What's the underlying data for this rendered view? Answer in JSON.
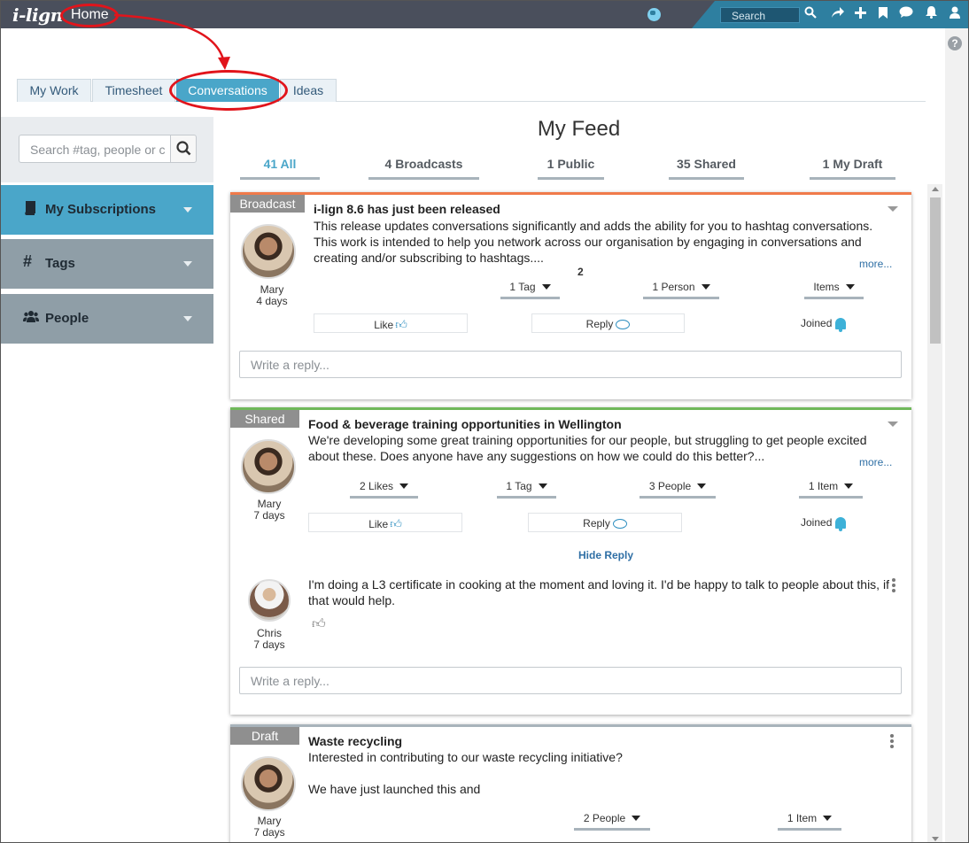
{
  "header": {
    "logo": "i-lign",
    "home": "Home",
    "search_placeholder": "Search",
    "icons": [
      "globe-icon",
      "search-icon",
      "share-icon",
      "plus-icon",
      "bookmark-icon",
      "chat-icon",
      "bell-icon",
      "user-icon"
    ]
  },
  "tabs": [
    "My Work",
    "Timesheet",
    "Conversations",
    "Ideas"
  ],
  "active_tab": "Conversations",
  "sidebar": {
    "search_placeholder": "Search #tag, people or c",
    "items": [
      {
        "label": "My Subscriptions",
        "icon": "book-icon",
        "color": "#4aa6c9"
      },
      {
        "label": "Tags",
        "icon": "hash-icon",
        "color": "#8f9ea7"
      },
      {
        "label": "People",
        "icon": "people-icon",
        "color": "#8f9ea7"
      }
    ]
  },
  "feed": {
    "title": "My Feed",
    "filters": [
      "41 All",
      "4 Broadcasts",
      "1 Public",
      "35 Shared",
      "1 My Draft"
    ]
  },
  "cards": [
    {
      "type": "Broadcast",
      "accent": "#f07a4a",
      "title": "i-lign 8.6 has just been released",
      "body": "This release updates conversations significantly and adds the ability for you to hashtag conversations.  This work is intended to help you network across our organisation by engaging in conversations and creating and/or subscribing to hashtags....",
      "more": "more...",
      "author": "Mary",
      "age": "4 days",
      "floating_count": "2",
      "meta": [
        "1 Tag",
        "1 Person",
        "Items"
      ],
      "like": "Like",
      "reply": "Reply",
      "joined": "Joined",
      "reply_placeholder": "Write a reply..."
    },
    {
      "type": "Shared",
      "accent": "#6fb85a",
      "title": "Food & beverage training opportunities in Wellington",
      "body": "We're developing some great training opportunities for our people, but struggling to get people excited about these. Does anyone have any suggestions on how we could do this better?...",
      "more": "more...",
      "author": "Mary",
      "age": "7 days",
      "meta": [
        "2 Likes",
        "1 Tag",
        "3 People",
        "1 Item"
      ],
      "like": "Like",
      "reply": "Reply",
      "joined": "Joined",
      "hide_reply": "Hide Reply",
      "comment": {
        "author": "Chris",
        "age": "7 days",
        "text": "I'm doing a L3 certificate in cooking at the moment and loving it. I'd be happy to talk to people about this, if that would help."
      },
      "reply_placeholder": "Write a reply..."
    },
    {
      "type": "Draft",
      "accent": "#a8b3bb",
      "title": "Waste recycling",
      "body_lines": [
        "Interested in contributing to our waste recycling initiative?",
        "We have just launched this and"
      ],
      "author": "Mary",
      "age": "7 days",
      "meta": [
        "2 People",
        "1 Item"
      ]
    }
  ]
}
